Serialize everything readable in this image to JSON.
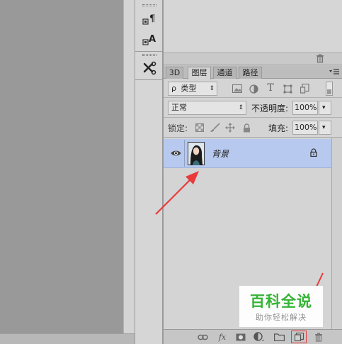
{
  "panel_tabs": [
    {
      "label": "3D",
      "active": false
    },
    {
      "label": "图层",
      "active": true
    },
    {
      "label": "通道",
      "active": false
    },
    {
      "label": "路径",
      "active": false
    }
  ],
  "filter": {
    "kind_label": "类型",
    "kind_prefix": "ρ"
  },
  "blend": {
    "mode": "正常",
    "opacity_label": "不透明度:",
    "opacity_value": "100%"
  },
  "lock": {
    "label": "锁定:",
    "fill_label": "填充:",
    "fill_value": "100%"
  },
  "layers": [
    {
      "name": "背景",
      "visible": true,
      "locked": true,
      "selected": true
    }
  ],
  "footer": {
    "fx_label": "fx"
  },
  "watermark": {
    "title": "百科全说",
    "subtitle": "助你轻松解决"
  },
  "colors": {
    "selection": "#b7c9ee",
    "annotation_red": "#e83a3a",
    "watermark_green": "#2fb32f",
    "canvas_gray": "#999999"
  }
}
